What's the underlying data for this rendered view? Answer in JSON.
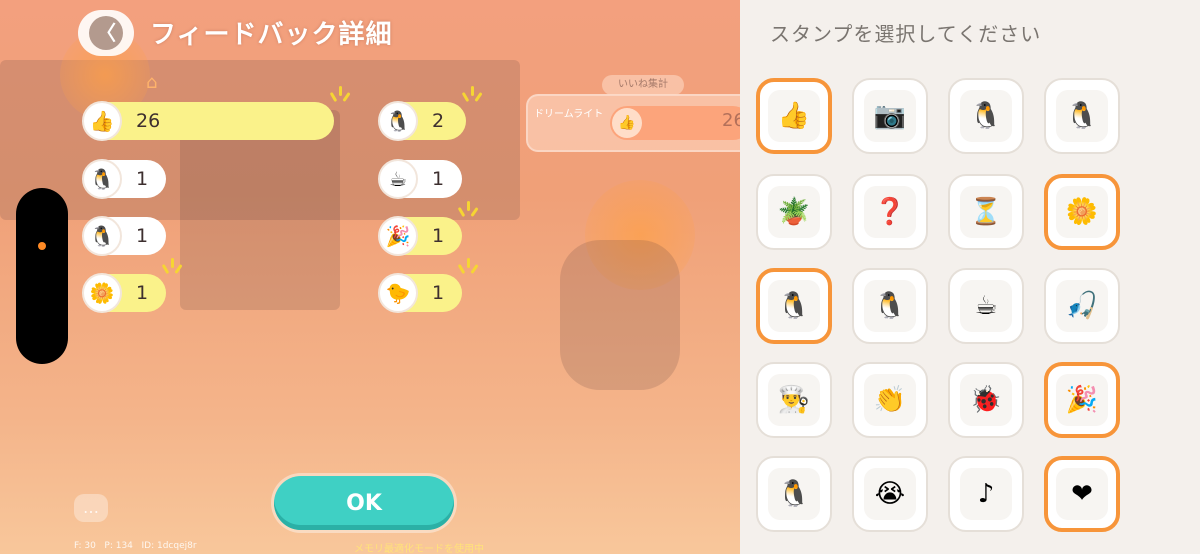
{
  "header": {
    "title": "フィードバック詳細",
    "back_symbol": "〈",
    "home_symbol": "⌂"
  },
  "feedback": {
    "left_column": [
      {
        "icon": "thumbs-up-icon",
        "glyph": "👍",
        "count": "26",
        "highlighted": true,
        "sparkle": true
      },
      {
        "icon": "bird-thumbs-up-icon",
        "glyph": "🐧",
        "count": "1",
        "highlighted": false,
        "sparkle": false
      },
      {
        "icon": "bird-question-icon",
        "glyph": "🐧",
        "count": "1",
        "highlighted": false,
        "sparkle": false
      },
      {
        "icon": "bird-flower-icon",
        "glyph": "🌼",
        "count": "1",
        "highlighted": true,
        "sparkle": true
      }
    ],
    "right_column": [
      {
        "icon": "bird-shy-icon",
        "glyph": "🐧",
        "count": "2",
        "highlighted": true,
        "sparkle": true
      },
      {
        "icon": "coffee-icon",
        "glyph": "☕",
        "count": "1",
        "highlighted": false,
        "sparkle": false
      },
      {
        "icon": "bird-party-icon",
        "glyph": "🎉",
        "count": "1",
        "highlighted": true,
        "sparkle": true
      },
      {
        "icon": "bird-heart-icon",
        "glyph": "🐤",
        "count": "1",
        "highlighted": true,
        "sparkle": true
      }
    ]
  },
  "summary": {
    "tab_label": "いいね集計",
    "label": "ドリームライト",
    "value": "26"
  },
  "ok_label": "OK",
  "chat_symbol": "…",
  "debug_text": "F: 30   P: 134   ID: 1dcqej8r",
  "memory_text": "メモリ最適化モードを使用中",
  "stamp_panel": {
    "title": "スタンプを選択してください",
    "accent": "#f7953a",
    "stamps": [
      {
        "name": "thumbs-up-stamp",
        "glyph": "👍",
        "selected": true
      },
      {
        "name": "camera-bird-stamp",
        "glyph": "📷",
        "selected": false
      },
      {
        "name": "smiling-bird-stamp",
        "glyph": "🐧",
        "selected": false
      },
      {
        "name": "bird-thumbs-up-stamp",
        "glyph": "🐧",
        "selected": false
      },
      {
        "name": "watering-can-stamp",
        "glyph": "🪴",
        "selected": false
      },
      {
        "name": "question-bird-stamp",
        "glyph": "❓",
        "selected": false
      },
      {
        "name": "hourglass-bird-stamp",
        "glyph": "⏳",
        "selected": false
      },
      {
        "name": "flower-bird-stamp",
        "glyph": "🌼",
        "selected": true
      },
      {
        "name": "shy-bird-stamp",
        "glyph": "🐧",
        "selected": true
      },
      {
        "name": "waving-bird-stamp",
        "glyph": "🐧",
        "selected": false
      },
      {
        "name": "coffee-bird-stamp",
        "glyph": "☕",
        "selected": false
      },
      {
        "name": "fishing-bird-stamp",
        "glyph": "🎣",
        "selected": false
      },
      {
        "name": "chef-bird-stamp",
        "glyph": "👨‍🍳",
        "selected": false
      },
      {
        "name": "clapping-bird-stamp",
        "glyph": "👏",
        "selected": false
      },
      {
        "name": "ladybug-bird-stamp",
        "glyph": "🐞",
        "selected": false
      },
      {
        "name": "party-bird-stamp",
        "glyph": "🎉",
        "selected": true
      },
      {
        "name": "crying-bird-stamp",
        "glyph": "🐧",
        "selected": false
      },
      {
        "name": "tearful-bird-stamp",
        "glyph": "😭",
        "selected": false
      },
      {
        "name": "music-note-stamp",
        "glyph": "♪",
        "selected": false
      },
      {
        "name": "bird-hug-stamp",
        "glyph": "❤",
        "selected": true
      }
    ]
  }
}
